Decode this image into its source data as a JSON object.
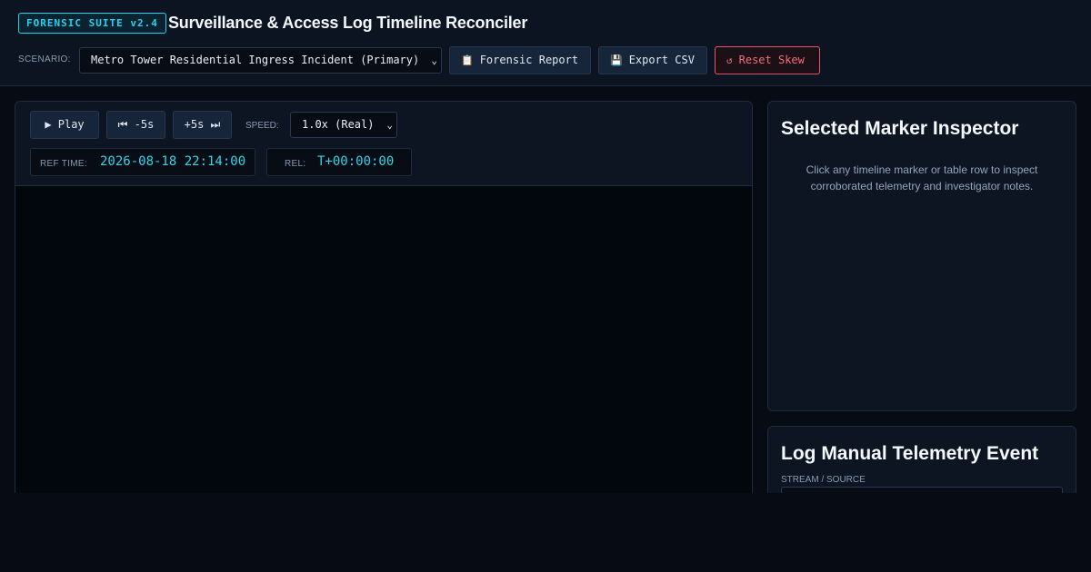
{
  "header": {
    "brand_badge": "FORENSIC SUITE v2.4",
    "title": "Surveillance & Access Log Timeline Reconciler",
    "scenario_label": "SCENARIO:",
    "scenario_selected": "Metro Tower Residential Ingress Incident (Primary)",
    "buttons": {
      "report_icon": "📋",
      "report_label": "Forensic Report",
      "export_icon": "💾",
      "export_label": "Export CSV",
      "reset_icon": "↺",
      "reset_label": "Reset Skew"
    }
  },
  "player": {
    "play_label": "▶  Play",
    "back_label": "⏮ -5s",
    "forward_label": "+5s ⏭",
    "speed_label": "SPEED:",
    "speed_selected": "1.0x (Real)",
    "ref_time_label": "REF TIME:",
    "ref_time_value": "2026-08-18 22:14:00",
    "rel_label": "REL:",
    "rel_value": "T+00:00:00"
  },
  "inspector": {
    "title": "Selected Marker Inspector",
    "hint": "Click any timeline marker or table row to inspect corroborated telemetry and investigator notes."
  },
  "log_event": {
    "title": "Log Manual Telemetry Event",
    "stream_label": "STREAM / SOURCE"
  },
  "colors": {
    "accent": "#22d3ee",
    "danger": "#f26b7d",
    "background": "#060b14",
    "panel": "#0d1522"
  }
}
